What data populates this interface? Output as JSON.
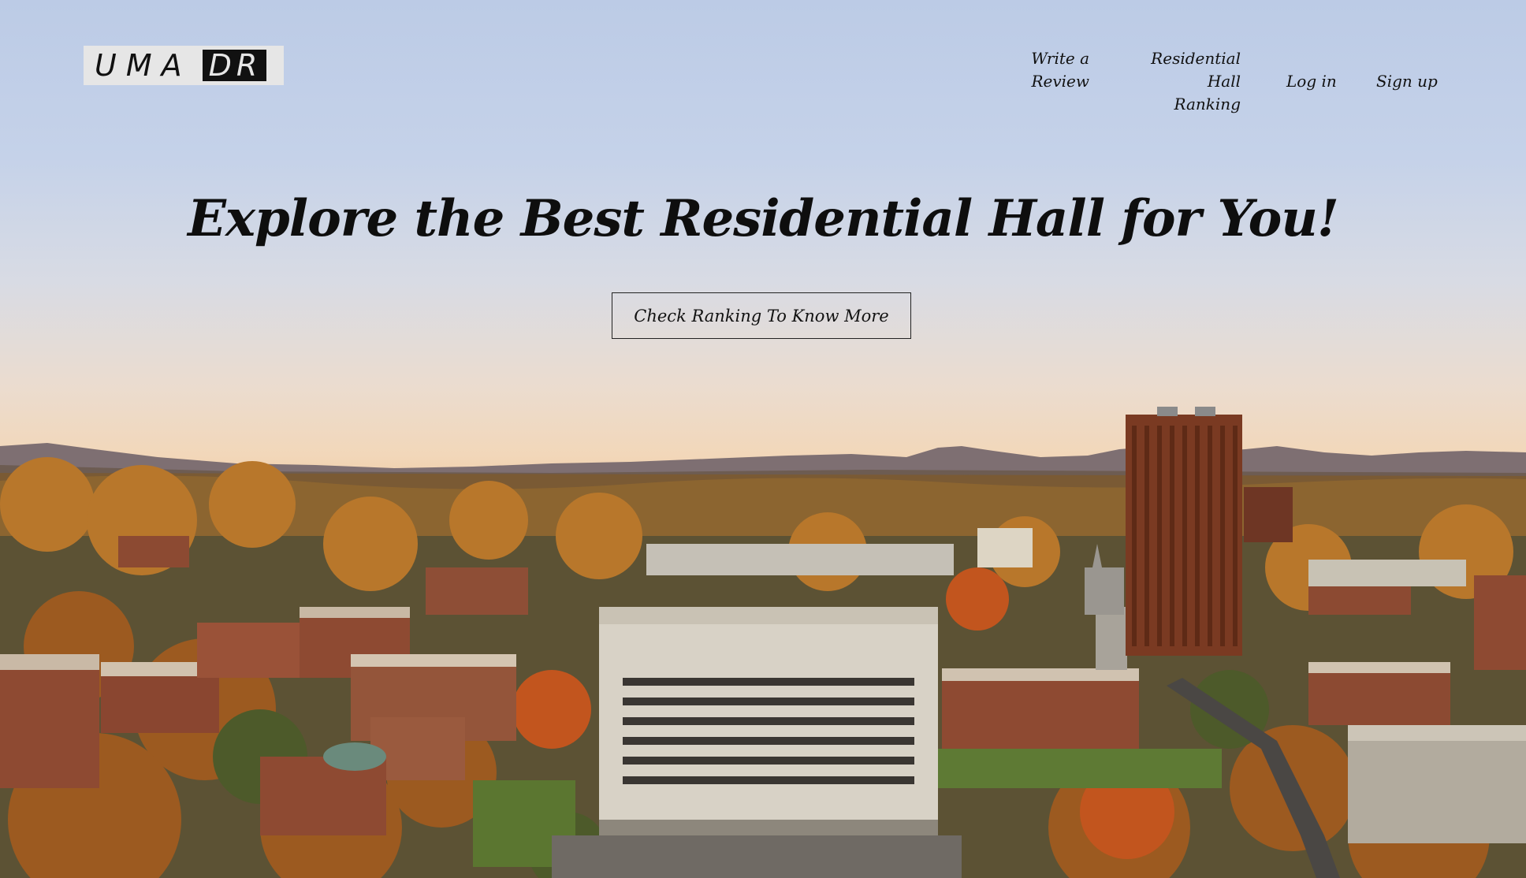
{
  "logo": {
    "left_text": "UMA",
    "right_text": "DR"
  },
  "nav": {
    "write_review_line1": "Write a",
    "write_review_line2": "Review",
    "ranking_line1": "Residential Hall",
    "ranking_line2": "Ranking",
    "login": "Log in",
    "signup": "Sign up"
  },
  "hero": {
    "headline": "Explore the Best Residential Hall for You!",
    "cta_label": "Check Ranking To Know More"
  },
  "colors": {
    "sky_top": "#bccbe6",
    "sky_horizon": "#ecc49b",
    "text": "#111111",
    "tower_brick": "#7a3a22",
    "foliage": "#b46a24"
  }
}
